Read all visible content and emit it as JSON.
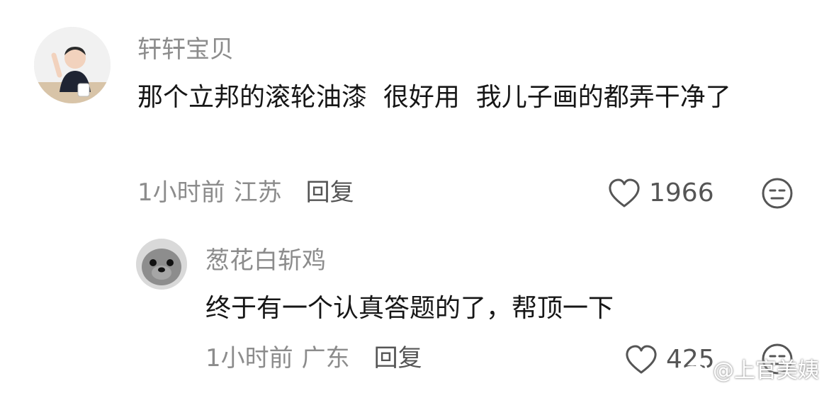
{
  "comments": [
    {
      "username": "轩轩宝贝",
      "text": "那个立邦的滚轮油漆  很好用  我儿子画的都弄干净了",
      "time": "1小时前",
      "location": "江苏",
      "reply_label": "回复",
      "likes": "1966",
      "avatar": "child-photo",
      "reaction_icon": "neutral-face-icon"
    },
    {
      "username": "葱花白斩鸡",
      "text": "终于有一个认真答题的了，帮顶一下",
      "time": "1小时前",
      "location": "广东",
      "reply_label": "回复",
      "likes": "425",
      "avatar": "seal-photo",
      "reaction_icon": "neutral-face-icon"
    }
  ],
  "watermark": {
    "text": "@上官美姨",
    "logo": "weibo-logo"
  },
  "colors": {
    "username": "#8c8c8c",
    "text": "#161616",
    "meta": "#8c8c8c",
    "reply": "#555555"
  }
}
